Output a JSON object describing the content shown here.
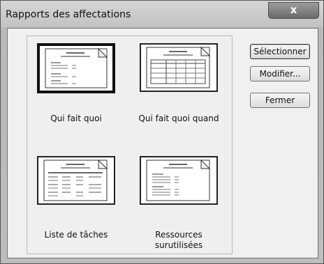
{
  "dialog": {
    "title": "Rapports des affectations",
    "close_label": "x"
  },
  "reports": [
    {
      "label": "Qui fait quoi",
      "selected": true
    },
    {
      "label": "Qui fait quoi quand",
      "selected": false
    },
    {
      "label": "Liste de tâches",
      "selected": false
    },
    {
      "label": "Ressources surutilisées",
      "selected": false
    }
  ],
  "buttons": {
    "select": "Sélectionner",
    "edit": "Modifier...",
    "close": "Fermer"
  }
}
